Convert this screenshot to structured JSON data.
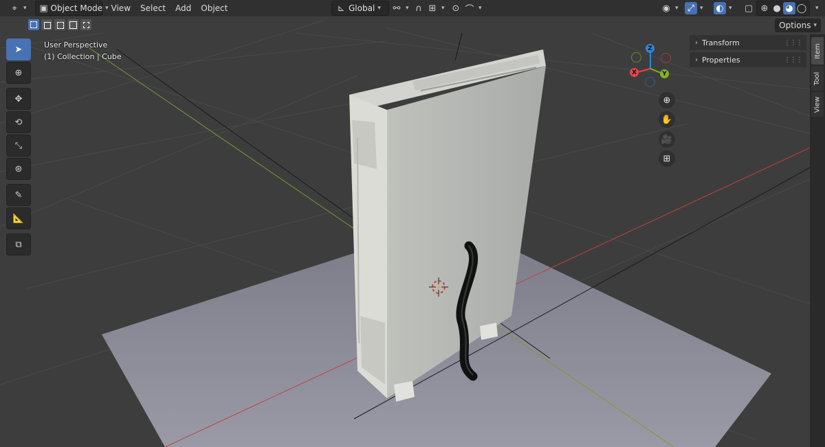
{
  "header": {
    "mode_label": "Object Mode",
    "menus": [
      "View",
      "Select",
      "Add",
      "Object"
    ],
    "orientation_label": "Global",
    "options_label": "Options"
  },
  "overlay": {
    "view_name": "User Perspective",
    "collection_label": "(1) Collection | Cube"
  },
  "gizmo": {
    "z_label": "Z",
    "x_label": "X",
    "y_label": "Y",
    "colors": {
      "x": "#e8434e",
      "y": "#7fb51e",
      "z": "#2e86d6"
    }
  },
  "side_panel": {
    "sections": [
      "Transform",
      "Properties"
    ],
    "tabs": [
      "Item",
      "Tool",
      "View"
    ]
  },
  "toolbar": {
    "tools": [
      "select-box",
      "cursor",
      "move",
      "rotate",
      "scale",
      "transform",
      "annotate",
      "measure",
      "add-cube"
    ]
  },
  "colors": {
    "accent": "#4772b3",
    "header_bg": "#303030",
    "viewport_bg": "#3d3d3d",
    "x_axis": "#c0403f",
    "y_axis": "#7d9b2e"
  }
}
